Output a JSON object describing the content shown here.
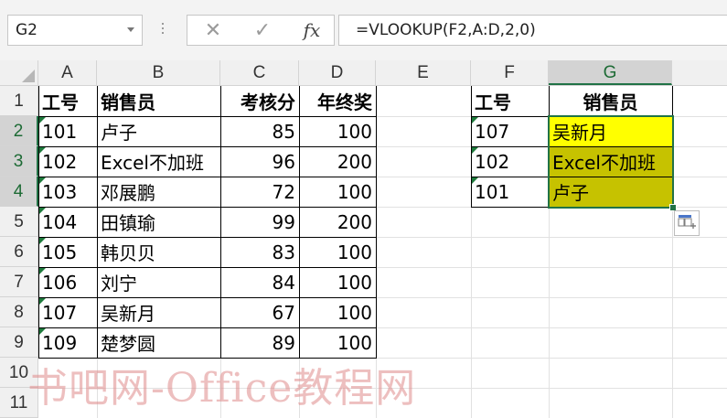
{
  "name_box": {
    "value": "G2"
  },
  "formula_bar": {
    "cancel_symbol": "✕",
    "enter_symbol": "✓",
    "fx_label": "fx",
    "formula": "=VLOOKUP(F2,A:D,2,0)"
  },
  "columns": [
    "A",
    "B",
    "C",
    "D",
    "E",
    "F",
    "G"
  ],
  "rows": [
    "1",
    "2",
    "3",
    "4",
    "5",
    "6",
    "7",
    "8",
    "9",
    "10",
    "11"
  ],
  "selected_cell": {
    "column": "G",
    "row": "2"
  },
  "table1": {
    "headers": [
      "工号",
      "销售员",
      "考核分",
      "年终奖"
    ],
    "rows": [
      [
        "101",
        "卢子",
        "85",
        "100"
      ],
      [
        "102",
        "Excel不加班",
        "96",
        "200"
      ],
      [
        "103",
        "邓展鹏",
        "72",
        "100"
      ],
      [
        "104",
        "田镇瑜",
        "99",
        "200"
      ],
      [
        "105",
        "韩贝贝",
        "83",
        "100"
      ],
      [
        "106",
        "刘宁",
        "84",
        "100"
      ],
      [
        "107",
        "吴新月",
        "67",
        "100"
      ],
      [
        "109",
        "楚梦圆",
        "89",
        "100"
      ]
    ]
  },
  "table2": {
    "headers": [
      "工号",
      "销售员"
    ],
    "rows": [
      [
        "107",
        "吴新月"
      ],
      [
        "102",
        "Excel不加班"
      ],
      [
        "101",
        "卢子"
      ]
    ]
  },
  "colors": {
    "selection": "#217346",
    "highlight_active": "#ffff00",
    "highlight_range": "#c6c200",
    "error_indicator": "#1e7a3c"
  },
  "watermark": {
    "text": "书吧网-Office教程网"
  }
}
